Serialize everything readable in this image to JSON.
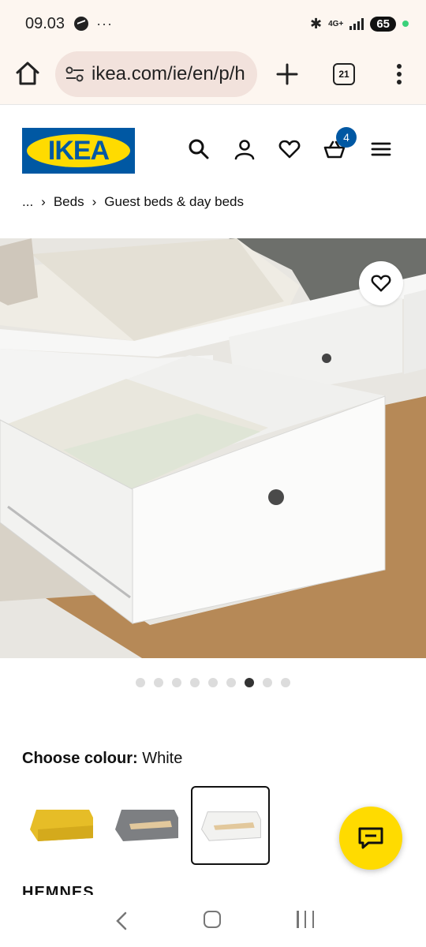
{
  "status_bar": {
    "time": "09.03",
    "dots": "···",
    "network": "4G+",
    "battery": "65"
  },
  "browser": {
    "url": "ikea.com/ie/en/p/h",
    "tab_count": "21"
  },
  "header": {
    "logo_text": "IKEA",
    "cart_count": "4"
  },
  "breadcrumb": {
    "ellipsis": "...",
    "items": [
      "Beds",
      "Guest beds & day beds"
    ]
  },
  "gallery": {
    "total_images": 9,
    "active_index": 6
  },
  "colour": {
    "label": "Choose colour:",
    "value": "White",
    "swatches": [
      {
        "color": "#e9bf2b"
      },
      {
        "color": "#7b7d80"
      },
      {
        "color": "#f4f4f2",
        "selected": true
      }
    ]
  },
  "product": {
    "name": "HEMNES"
  },
  "colors": {
    "ikea_blue": "#0058a3",
    "ikea_yellow": "#ffdb00",
    "browser_bg": "#fdf6f0"
  }
}
